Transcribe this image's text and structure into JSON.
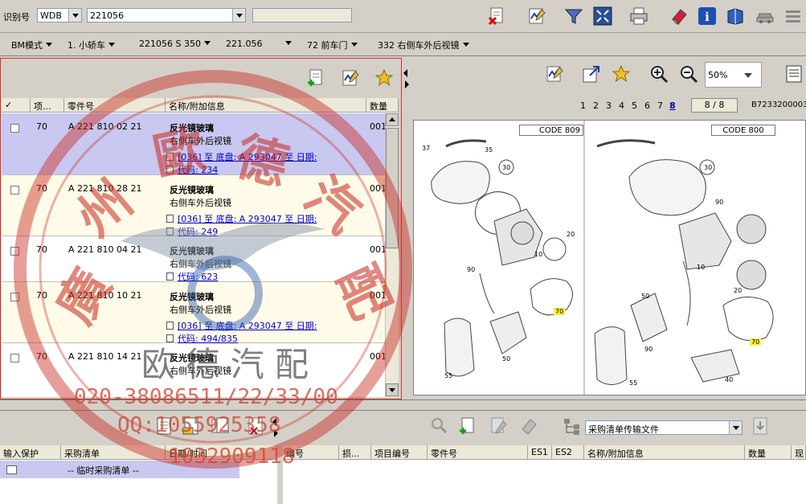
{
  "top": {
    "ident_label": "识别号",
    "ident_prefix": "WDB",
    "ident_value": "221056",
    "ident_extra": ""
  },
  "breadcrumb": {
    "mode": "BM模式",
    "class": "1. 小轿车",
    "model": "221056 S 350",
    "variant": "221.056",
    "group": "72 前车门",
    "subgroup": "332 右侧车外后视镜"
  },
  "parts_table": {
    "headers": [
      "✓",
      "项...",
      "零件号",
      "名称/附加信息",
      "数量"
    ],
    "rows": [
      {
        "item": "70",
        "part": "A 221 810 02 21",
        "name": "反光镜玻璃",
        "desc": "右侧车外后视镜",
        "note1": "[036] 至 底盘: A 293047 至 日期:",
        "note2": "代码: 234",
        "qty": "001"
      },
      {
        "item": "70",
        "part": "A 221 810 28 21",
        "name": "反光镜玻璃",
        "desc": "右侧车外后视镜",
        "note1": "[036] 至 底盘: A 293047 至 日期:",
        "note2": "代码: 249",
        "qty": "001"
      },
      {
        "item": "70",
        "part": "A 221 810 04 21",
        "name": "反光镜玻璃",
        "desc": "右侧车外后视镜",
        "note1": "",
        "note2": "代码: 623",
        "qty": "001"
      },
      {
        "item": "70",
        "part": "A 221 810 10 21",
        "name": "反光镜玻璃",
        "desc": "右侧车外后视镜",
        "note1": "[036] 至 底盘: A 293047 至 日期:",
        "note2": "代码: 494/835",
        "qty": "001"
      },
      {
        "item": "70",
        "part": "A 221 810 14 21",
        "name": "反光镜玻璃",
        "desc": "右侧车外后视镜",
        "note1": "",
        "note2": "",
        "qty": "001"
      }
    ]
  },
  "diagram": {
    "zoom": "50%",
    "pages": [
      "1",
      "2",
      "3",
      "4",
      "5",
      "6",
      "7",
      "8"
    ],
    "current_page": "8",
    "page_count": "8 / 8",
    "doc_id": "B7233200003",
    "code_left": "CODE 809",
    "code_right": "CODE 800",
    "labels": [
      "37",
      "35",
      "30",
      "20",
      "90",
      "10",
      "70",
      "50",
      "55",
      "30",
      "90",
      "10",
      "20",
      "50",
      "70",
      "90",
      "55",
      "40"
    ]
  },
  "bottom_left": {
    "headers": [
      "输入保护",
      "采购清单",
      "日期/时间"
    ],
    "row_text": "-- 临时采购清单 --"
  },
  "bottom_right": {
    "dropdown": "采购清单传输文件",
    "headers": [
      "编号",
      "损...",
      "项目编号",
      "零件号",
      "ES1",
      "ES2",
      "名称/附加信息",
      "数量",
      "现"
    ]
  },
  "watermark": {
    "chars": [
      "廣",
      "州",
      "歐",
      "德",
      "汽",
      "配"
    ],
    "logo_text": "欧 德 汽 配",
    "phone": "020-38086511/22/33/00",
    "qq": "QQ:1055925358",
    "qq2": "1032909118"
  },
  "colors": {
    "selected_row": "#c8c8f0",
    "alt_row": "#fffbe8",
    "watermark_red": "#c8281e"
  }
}
